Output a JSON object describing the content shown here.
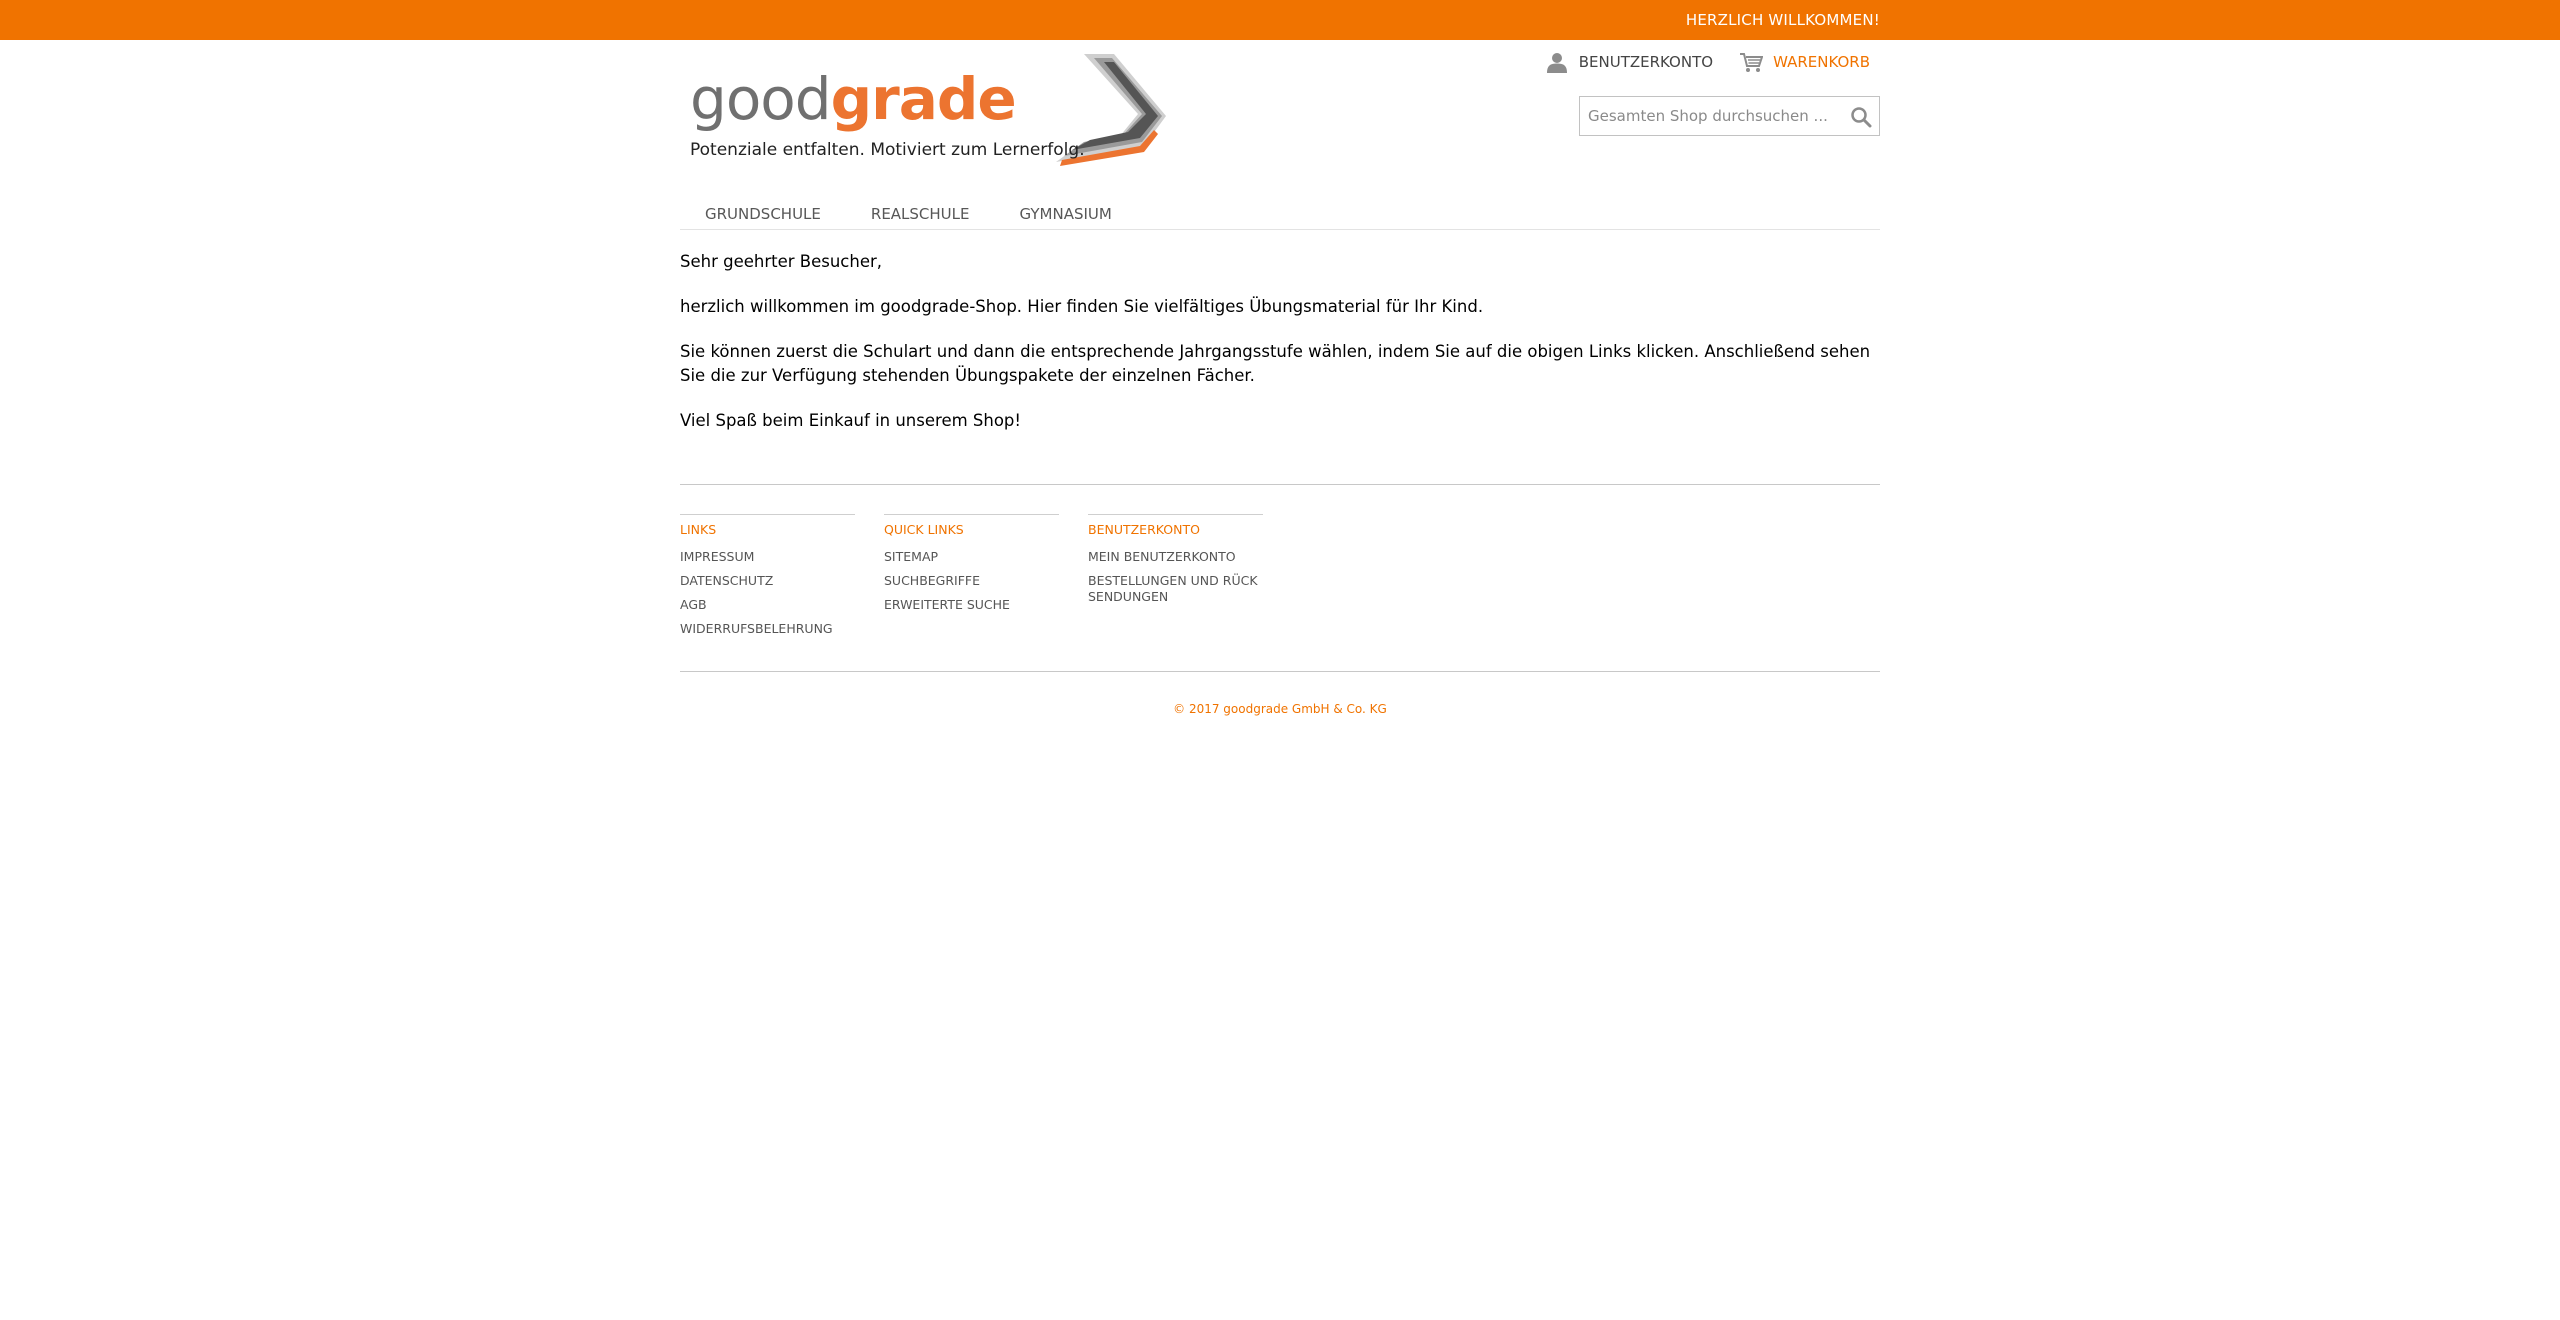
{
  "topbar": {
    "welcome": "HERZLICH WILLKOMMEN!"
  },
  "logo": {
    "word_good": "good",
    "word_grade": "grade",
    "tagline": "Potenziale entfalten. Motiviert zum Lernerfolg."
  },
  "account": {
    "account_label": "BENUTZERKONTO",
    "cart_label": "WARENKORB"
  },
  "search": {
    "placeholder": "Gesamten Shop durchsuchen ..."
  },
  "nav": {
    "items": [
      {
        "label": "GRUNDSCHULE"
      },
      {
        "label": "REALSCHULE"
      },
      {
        "label": "GYMNASIUM"
      }
    ]
  },
  "content": {
    "paragraphs": [
      "Sehr geehrter Besucher,",
      "herzlich willkommen im goodgrade-Shop. Hier finden Sie vielfältiges Übungsmaterial für Ihr Kind.",
      "Sie können zuerst die Schulart und dann die entsprechende Jahrgangsstufe wählen, indem Sie auf die obigen Links klicken. Anschließend sehen Sie die zur Verfügung stehenden Übungspakete der einzelnen Fächer.",
      "Viel Spaß beim Einkauf in unserem Shop!"
    ]
  },
  "footer": {
    "columns": [
      {
        "heading": "LINKS",
        "links": [
          "IMPRESSUM",
          "DATENSCHUTZ",
          "AGB",
          "WIDERRUFSBELEHRUNG"
        ]
      },
      {
        "heading": "QUICK LINKS",
        "links": [
          "SITEMAP",
          "SUCHBEGRIFFE",
          "ERWEITERTE SUCHE"
        ]
      },
      {
        "heading": "BENUTZERKONTO",
        "links": [
          "MEIN BENUTZERKONTO",
          "BESTELLUNGEN UND RÜCKSENDUNGEN"
        ]
      }
    ],
    "copyright": "© 2017 goodgrade GmbH & Co. KG"
  },
  "colors": {
    "brand_orange": "#f07300",
    "logo_orange": "#ec7430",
    "logo_grey": "#707070"
  },
  "icons": {
    "account": "user-icon",
    "cart": "cart-icon",
    "search": "search-icon"
  }
}
